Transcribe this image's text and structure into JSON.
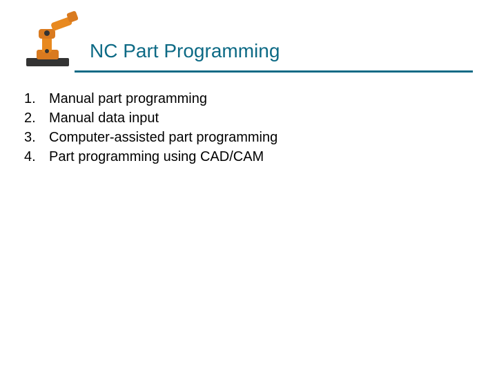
{
  "title": "NC Part Programming",
  "items": [
    {
      "number": "1.",
      "text": "Manual part programming"
    },
    {
      "number": "2.",
      "text": "Manual data input"
    },
    {
      "number": "3.",
      "text": "Computer-assisted part programming"
    },
    {
      "number": "4.",
      "text": "Part programming using CAD/CAM"
    }
  ]
}
